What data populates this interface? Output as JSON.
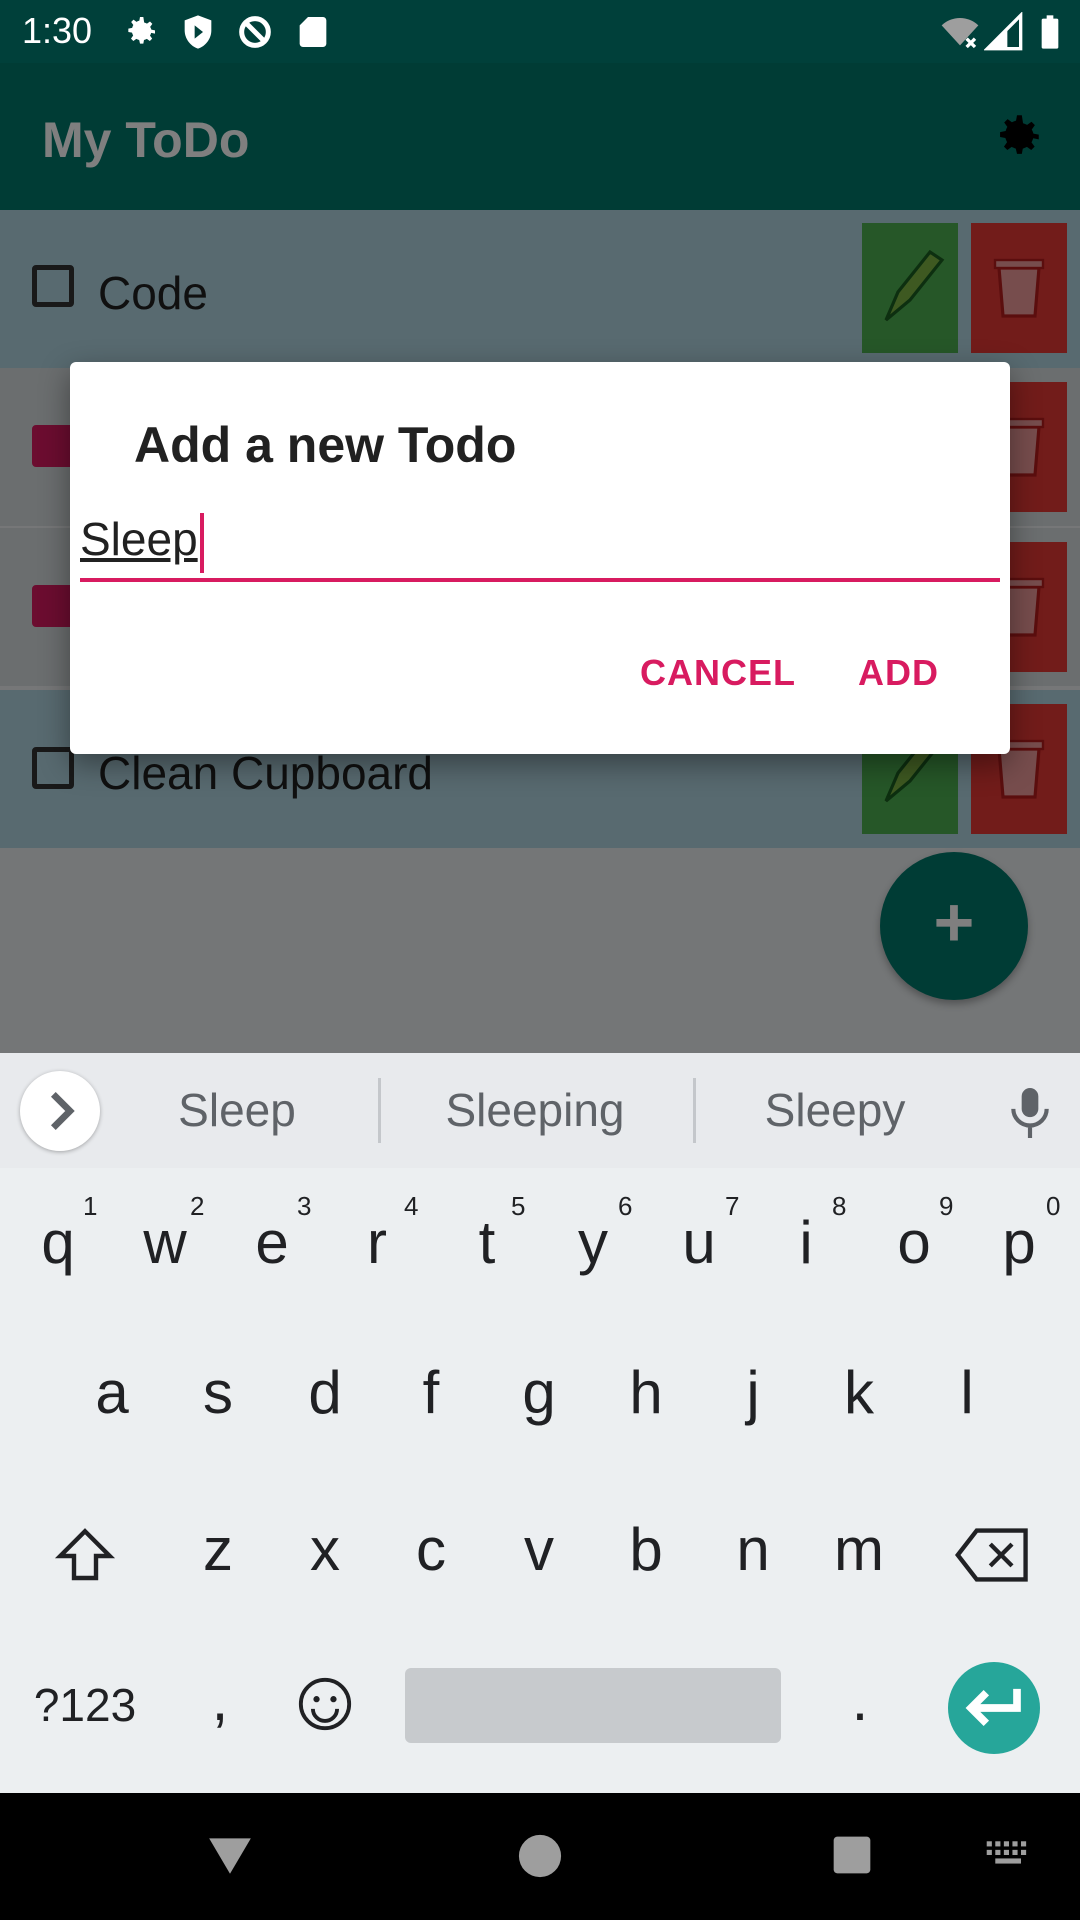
{
  "status_bar": {
    "time": "1:30"
  },
  "app_bar": {
    "title": "My ToDo"
  },
  "todos": [
    {
      "label": "Code",
      "checked": false
    },
    {
      "label": "",
      "checked": true
    },
    {
      "label": "",
      "checked": true
    },
    {
      "label": "Clean Cupboard",
      "checked": false
    }
  ],
  "dialog": {
    "title": "Add a new Todo",
    "input_value": "Sleep",
    "cancel_label": "CANCEL",
    "add_label": "ADD"
  },
  "keyboard": {
    "suggestions": [
      "Sleep",
      "Sleeping",
      "Sleepy"
    ],
    "row1": [
      "q",
      "w",
      "e",
      "r",
      "t",
      "y",
      "u",
      "i",
      "o",
      "p"
    ],
    "row1_hints": [
      "1",
      "2",
      "3",
      "4",
      "5",
      "6",
      "7",
      "8",
      "9",
      "0"
    ],
    "row2": [
      "a",
      "s",
      "d",
      "f",
      "g",
      "h",
      "j",
      "k",
      "l"
    ],
    "row3": [
      "z",
      "x",
      "c",
      "v",
      "b",
      "n",
      "m"
    ],
    "symbols_label": "?123",
    "comma": ",",
    "period": "."
  },
  "colors": {
    "primary": "#00796B",
    "accent": "#D81B60",
    "edit": "#4CAF50",
    "delete": "#E53935"
  }
}
